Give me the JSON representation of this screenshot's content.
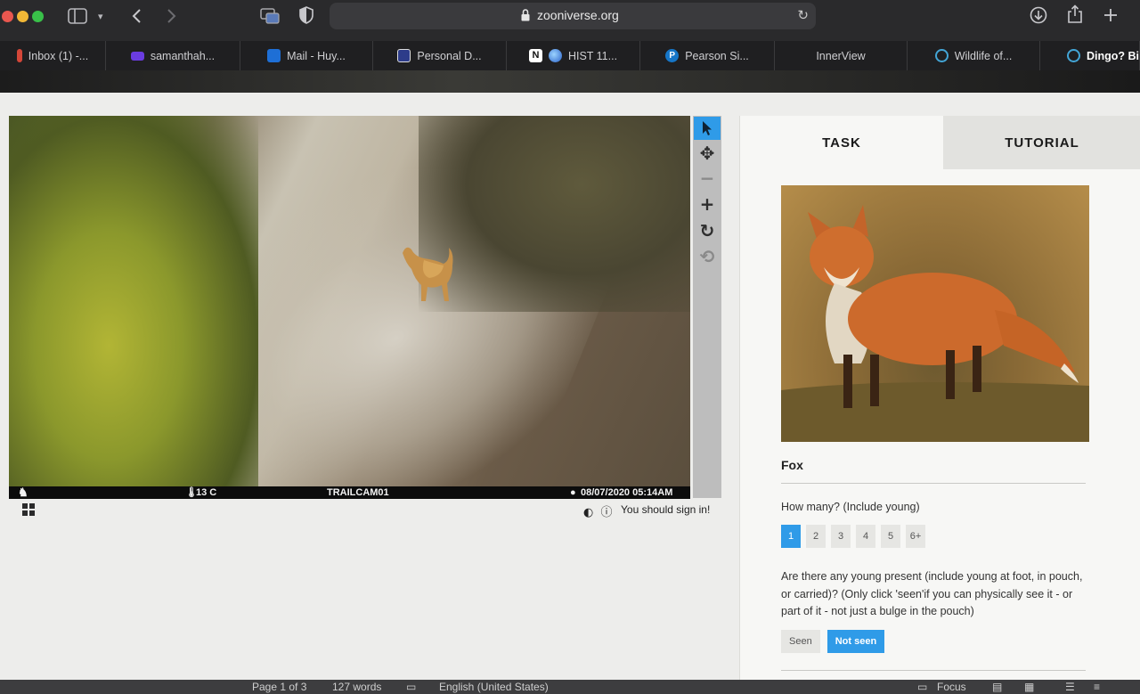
{
  "browser": {
    "url": "zooniverse.org",
    "tabs": [
      {
        "label": "Inbox (1) -...",
        "icon": "gmail-icon",
        "color": "#d44638"
      },
      {
        "label": "samanthah...",
        "icon": "mail-icon",
        "color": "#6a3ce0"
      },
      {
        "label": "Mail - Huy...",
        "icon": "outlook-icon",
        "color": "#1e6fd6"
      },
      {
        "label": "Personal D...",
        "icon": "document-icon",
        "color": "#2d3c8a"
      },
      {
        "label": "HIST 11...",
        "icon": "notion-icon",
        "color": "#ffffff"
      },
      {
        "label": "Pearson Si...",
        "icon": "pearson-icon",
        "color": "#1676c8"
      },
      {
        "label": "InnerView",
        "icon": "",
        "color": ""
      },
      {
        "label": "Wildlife of...",
        "icon": "zooniverse-icon",
        "color": "#43a5d6"
      },
      {
        "label": "Dingo? Bin",
        "icon": "zooniverse-icon",
        "color": "#43a5d6",
        "active": true
      }
    ]
  },
  "subject": {
    "camera_temp": "13 C",
    "camera_name": "TRAILCAM01",
    "camera_datetime": "08/07/2020 05:14AM",
    "sign_in_notice": "You should sign in!"
  },
  "task_panel": {
    "tab_task": "TASK",
    "tab_tutorial": "TUTORIAL",
    "species_name": "Fox",
    "question_count": "How many? (Include young)",
    "count_options": [
      "1",
      "2",
      "3",
      "4",
      "5",
      "6+"
    ],
    "count_selected": "1",
    "question_young": "Are there any young present (include young at foot, in pouch, or carried)? (Only click 'seen'if you can physically see it - or part of it - not just a bulge in the pouch)",
    "young_options": [
      "Seen",
      "Not seen"
    ],
    "young_selected": "Not seen"
  },
  "statusbar": {
    "page": "Page 1 of 3",
    "words": "127 words",
    "language": "English (United States)",
    "focus": "Focus"
  },
  "colors": {
    "accent": "#2f9be8"
  }
}
